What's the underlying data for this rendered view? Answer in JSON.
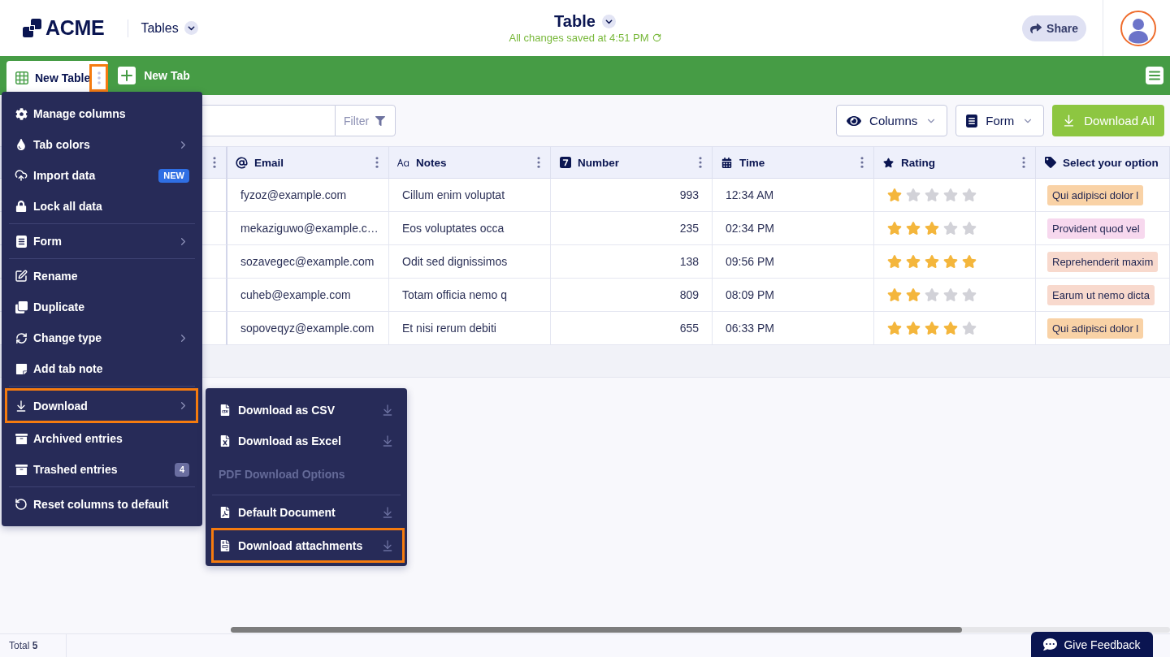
{
  "header": {
    "logo": "ACME",
    "app_menu": "Tables",
    "title": "Table",
    "save_status": "All changes saved at 4:51 PM",
    "share_button": "Share"
  },
  "tabs": [
    {
      "label": "New Table",
      "selected": true,
      "menu_button_highlighted": true
    }
  ],
  "add_tab_button": "New Tab",
  "toolbar": {
    "filter_button": "Filter",
    "columns_button": "Columns",
    "form_button": "Form",
    "download_all_button": "Download All"
  },
  "table": {
    "columns": [
      {
        "label": "Email",
        "kind": "email"
      },
      {
        "label": "Notes",
        "kind": "text"
      },
      {
        "label": "Number",
        "kind": "number"
      },
      {
        "label": "Time",
        "kind": "time"
      },
      {
        "label": "Rating",
        "kind": "rating"
      },
      {
        "label": "Select your option",
        "kind": "select"
      }
    ],
    "rows": [
      {
        "email": "fyzoz@example.com",
        "notes": "Cillum enim voluptat",
        "number": "993",
        "time": "12:34 AM",
        "stars": 1,
        "option": {
          "label": "Qui adipisci dolor l",
          "color": "#f9d2a6"
        }
      },
      {
        "email": "mekaziguwo@example.c…",
        "notes": "Eos voluptates occa",
        "number": "235",
        "time": "02:34 PM",
        "stars": 3,
        "option": {
          "label": "Provident quod vel",
          "color": "#f7d8ee"
        }
      },
      {
        "email": "sozavegec@example.com",
        "notes": "Odit sed dignissimos",
        "number": "138",
        "time": "09:56 PM",
        "stars": 5,
        "option": {
          "label": "Reprehenderit maxim",
          "color": "#f8d9cd"
        }
      },
      {
        "email": "cuheb@example.com",
        "notes": "Totam officia nemo q",
        "number": "809",
        "time": "08:09 PM",
        "stars": 2,
        "option": {
          "label": "Earum ut nemo dicta",
          "color": "#f8d9cd"
        }
      },
      {
        "email": "sopoveqyz@example.com",
        "notes": "Et nisi rerum debiti",
        "number": "655",
        "time": "06:33 PM",
        "stars": 4,
        "option": {
          "label": "Qui adipisci dolor l",
          "color": "#f9d2a6"
        }
      }
    ]
  },
  "tab_menu": {
    "groups": [
      {
        "items": [
          {
            "label": "Manage columns",
            "has_submenu": false,
            "highlighted": false
          },
          {
            "label": "Tab colors",
            "has_submenu": true,
            "highlighted": false
          },
          {
            "label": "Import data",
            "has_submenu": false,
            "highlighted": false,
            "badge": {
              "text": "NEW",
              "kind": "new"
            }
          },
          {
            "label": "Lock all data",
            "has_submenu": false,
            "highlighted": false
          }
        ]
      },
      {
        "items": [
          {
            "label": "Form",
            "has_submenu": true,
            "highlighted": false
          }
        ]
      },
      {
        "items": [
          {
            "label": "Rename",
            "has_submenu": false,
            "highlighted": false
          },
          {
            "label": "Duplicate",
            "has_submenu": false,
            "highlighted": false
          },
          {
            "label": "Change type",
            "has_submenu": true,
            "highlighted": false
          },
          {
            "label": "Add tab note",
            "has_submenu": false,
            "highlighted": false
          }
        ]
      },
      {
        "items": [
          {
            "label": "Download",
            "has_submenu": true,
            "highlighted": true
          },
          {
            "label": "Archived entries",
            "has_submenu": false,
            "highlighted": false
          },
          {
            "label": "Trashed entries",
            "has_submenu": false,
            "highlighted": false,
            "badge": {
              "text": "4",
              "kind": "count"
            }
          }
        ]
      },
      {
        "items": [
          {
            "label": "Reset columns to default",
            "has_submenu": false,
            "highlighted": false
          }
        ]
      }
    ]
  },
  "download_submenu": {
    "groups": [
      {
        "items": [
          {
            "kind": "action",
            "label": "Download as CSV",
            "highlighted": false
          },
          {
            "kind": "action",
            "label": "Download as Excel",
            "highlighted": false
          },
          {
            "kind": "heading",
            "label": "PDF Download Options"
          }
        ]
      },
      {
        "items": [
          {
            "kind": "action",
            "label": "Default Document",
            "highlighted": false
          },
          {
            "kind": "action",
            "label": "Download attachments",
            "highlighted": true
          }
        ]
      }
    ]
  },
  "status_bar": {
    "total": "Total **5**",
    "feedback_button": "Give Feedback"
  }
}
